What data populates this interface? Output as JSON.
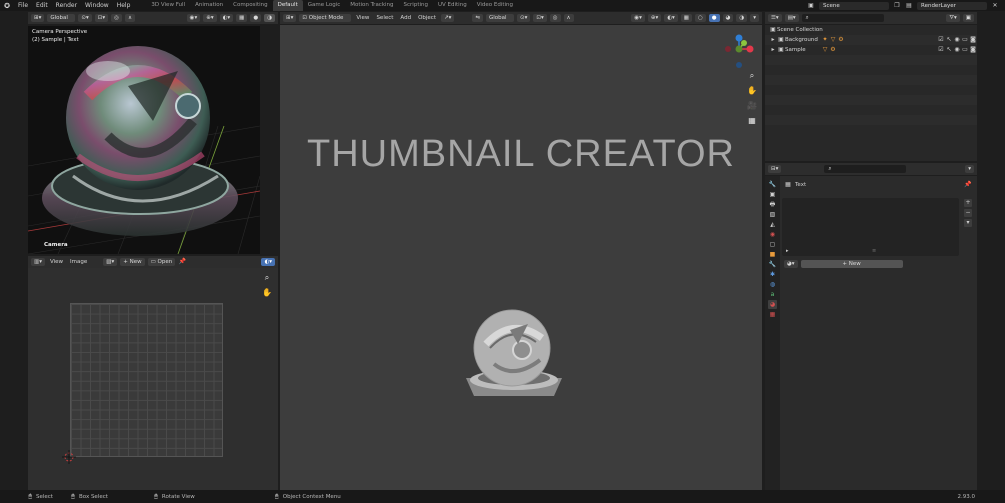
{
  "topbar": {
    "menus": [
      "File",
      "Edit",
      "Render",
      "Window",
      "Help"
    ],
    "workspaces": [
      "3D View Full",
      "Animation",
      "Compositing",
      "Default",
      "Game Logic",
      "Motion Tracking",
      "Scripting",
      "UV Editing",
      "Video Editing"
    ],
    "active_workspace": "Default",
    "scene": "Scene",
    "view_layer": "RenderLayer"
  },
  "camera_view": {
    "orientation": "Global",
    "title_line1": "Camera Perspective",
    "title_line2": "(2) Sample | Text",
    "camera_label": "Camera"
  },
  "image_editor": {
    "menus": [
      "View",
      "Image"
    ],
    "new_label": "New",
    "open_label": "Open"
  },
  "viewport": {
    "mode": "Object Mode",
    "menus": [
      "View",
      "Select",
      "Add",
      "Object"
    ],
    "orientation": "Global",
    "title": "THUMBNAIL CREATOR"
  },
  "outliner": {
    "collection": "Scene Collection",
    "items": [
      "Background",
      "Sample"
    ]
  },
  "properties": {
    "material_slot": "Text",
    "new_label": "New"
  },
  "statusbar": {
    "select": "Select",
    "box_select": "Box Select",
    "rotate": "Rotate View",
    "context": "Object Context Menu",
    "version": "2.93.0"
  },
  "colors": {
    "accent": "#4772b3",
    "axis_x": "#e2394b",
    "axis_y": "#8cc63f",
    "axis_z": "#2f7fd6"
  }
}
